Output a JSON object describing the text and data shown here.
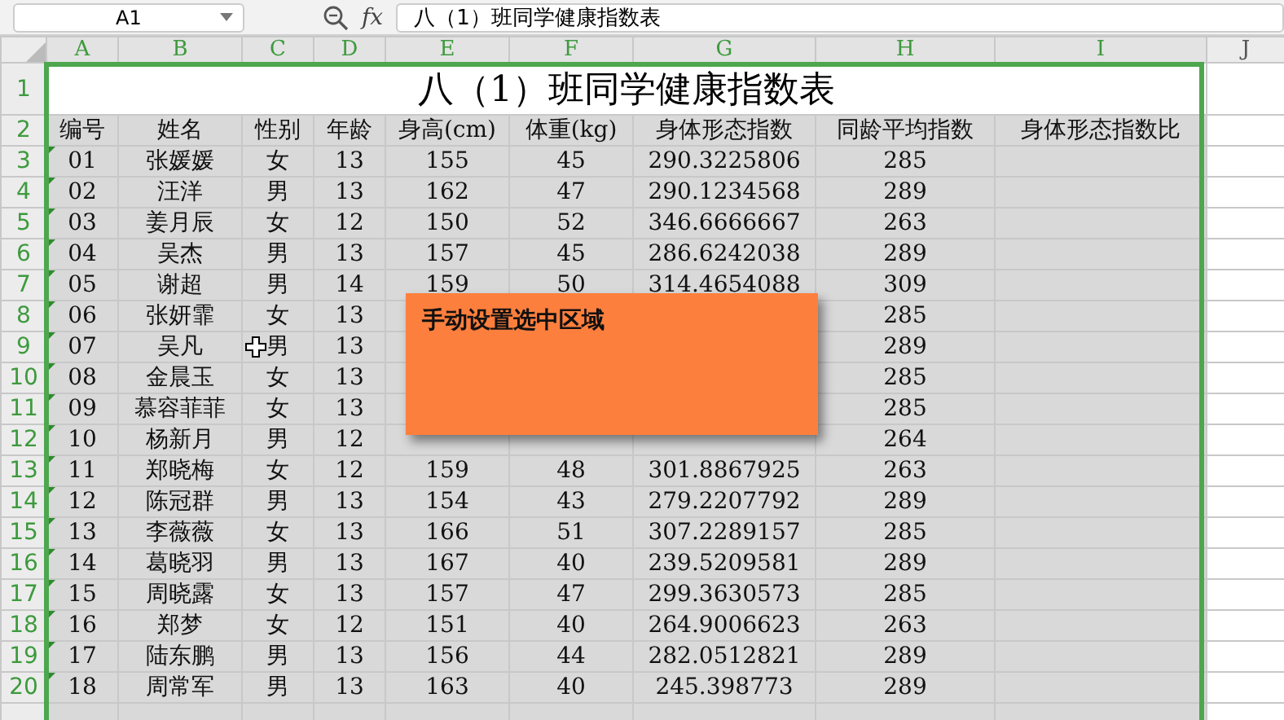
{
  "formula_bar": {
    "name_box": "A1",
    "function_label": "fx",
    "formula": "八（1）班同学健康指数表"
  },
  "columns": [
    {
      "label": "A",
      "selected": true
    },
    {
      "label": "B",
      "selected": true
    },
    {
      "label": "C",
      "selected": true
    },
    {
      "label": "D",
      "selected": true
    },
    {
      "label": "E",
      "selected": true
    },
    {
      "label": "F",
      "selected": true
    },
    {
      "label": "G",
      "selected": true
    },
    {
      "label": "H",
      "selected": true
    },
    {
      "label": "I",
      "selected": true
    },
    {
      "label": "J",
      "selected": false
    }
  ],
  "title": {
    "row": "1",
    "text": "八（1）班同学健康指数表"
  },
  "header": {
    "row": "2",
    "cells": [
      "编号",
      "姓名",
      "性别",
      "年龄",
      "身高(cm)",
      "体重(kg)",
      "身体形态指数",
      "同龄平均指数",
      "身体形态指数比"
    ]
  },
  "records": [
    {
      "row": "3",
      "number_as_text": true,
      "cells": [
        "01",
        "张媛媛",
        "女",
        "13",
        "155",
        "45",
        "290.3225806",
        "285"
      ]
    },
    {
      "row": "4",
      "number_as_text": true,
      "cells": [
        "02",
        "汪洋",
        "男",
        "13",
        "162",
        "47",
        "290.1234568",
        "289"
      ]
    },
    {
      "row": "5",
      "number_as_text": true,
      "cells": [
        "03",
        "姜月辰",
        "女",
        "12",
        "150",
        "52",
        "346.6666667",
        "263"
      ]
    },
    {
      "row": "6",
      "number_as_text": true,
      "cells": [
        "04",
        "吴杰",
        "男",
        "13",
        "157",
        "45",
        "286.6242038",
        "289"
      ]
    },
    {
      "row": "7",
      "number_as_text": true,
      "cells": [
        "05",
        "谢超",
        "男",
        "14",
        "159",
        "50",
        "314.4654088",
        "309"
      ]
    },
    {
      "row": "8",
      "number_as_text": true,
      "cells": [
        "06",
        "张妍霏",
        "女",
        "13",
        null,
        null,
        null,
        "285"
      ]
    },
    {
      "row": "9",
      "number_as_text": true,
      "cells": [
        "07",
        "吴凡",
        "男",
        "13",
        null,
        null,
        null,
        "289"
      ]
    },
    {
      "row": "10",
      "number_as_text": true,
      "cells": [
        "08",
        "金晨玉",
        "女",
        "13",
        null,
        null,
        null,
        "285"
      ]
    },
    {
      "row": "11",
      "number_as_text": true,
      "cells": [
        "09",
        "慕容菲菲",
        "女",
        "13",
        null,
        null,
        null,
        "285"
      ]
    },
    {
      "row": "12",
      "number_as_text": true,
      "cells": [
        "10",
        "杨新月",
        "男",
        "12",
        null,
        null,
        null,
        "264"
      ]
    },
    {
      "row": "13",
      "number_as_text": true,
      "cells": [
        "11",
        "郑晓梅",
        "女",
        "12",
        "159",
        "48",
        "301.8867925",
        "263"
      ]
    },
    {
      "row": "14",
      "number_as_text": true,
      "cells": [
        "12",
        "陈冠群",
        "男",
        "13",
        "154",
        "43",
        "279.2207792",
        "289"
      ]
    },
    {
      "row": "15",
      "number_as_text": true,
      "cells": [
        "13",
        "李薇薇",
        "女",
        "13",
        "166",
        "51",
        "307.2289157",
        "285"
      ]
    },
    {
      "row": "16",
      "number_as_text": true,
      "cells": [
        "14",
        "葛晓羽",
        "男",
        "13",
        "167",
        "40",
        "239.5209581",
        "289"
      ]
    },
    {
      "row": "17",
      "number_as_text": true,
      "cells": [
        "15",
        "周晓露",
        "女",
        "13",
        "157",
        "47",
        "299.3630573",
        "285"
      ]
    },
    {
      "row": "18",
      "number_as_text": true,
      "cells": [
        "16",
        "郑梦",
        "女",
        "12",
        "151",
        "40",
        "264.9006623",
        "263"
      ]
    },
    {
      "row": "19",
      "number_as_text": true,
      "cells": [
        "17",
        "陆东鹏",
        "男",
        "13",
        "156",
        "44",
        "282.0512821",
        "289"
      ]
    },
    {
      "row": "20",
      "number_as_text": true,
      "cells": [
        "18",
        "周常军",
        "男",
        "13",
        "163",
        "40",
        "245.398773",
        "289"
      ]
    }
  ],
  "popup": {
    "text": "手动设置选中区域"
  }
}
